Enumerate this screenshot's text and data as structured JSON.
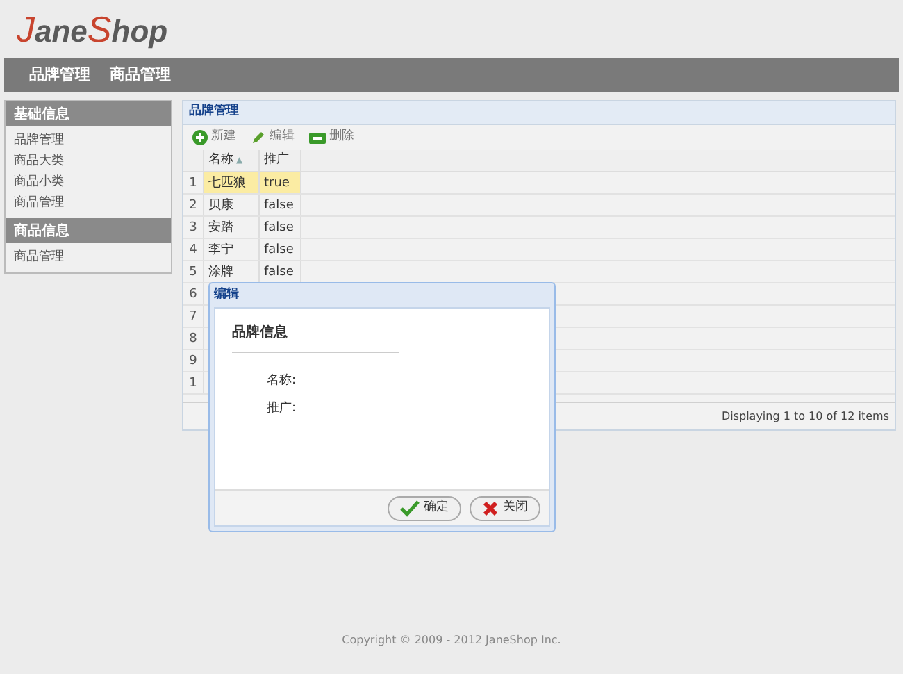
{
  "logo": {
    "parts": [
      "J",
      "ane",
      "S",
      "hop"
    ]
  },
  "nav": [
    "品牌管理",
    "商品管理"
  ],
  "sidebar": [
    {
      "title": "基础信息",
      "items": [
        "品牌管理",
        "商品大类",
        "商品小类",
        "商品管理"
      ]
    },
    {
      "title": "商品信息",
      "items": [
        "商品管理"
      ]
    }
  ],
  "panel": {
    "title": "品牌管理",
    "toolbar": [
      {
        "kind": "add",
        "label": "新建"
      },
      {
        "kind": "edit",
        "label": "编辑"
      },
      {
        "kind": "remove",
        "label": "删除"
      }
    ],
    "columns": [
      {
        "label": "名称",
        "sort_arrow": "▲"
      },
      {
        "label": "推广"
      }
    ],
    "rows": [
      {
        "index": "1",
        "cells": [
          "七匹狼",
          "true"
        ],
        "selected": true
      },
      {
        "index": "2",
        "cells": [
          "贝康",
          "false"
        ],
        "selected": false
      },
      {
        "index": "3",
        "cells": [
          "安踏",
          "false"
        ],
        "selected": false
      },
      {
        "index": "4",
        "cells": [
          "李宁",
          "false"
        ],
        "selected": false
      },
      {
        "index": "5",
        "cells": [
          "涂牌",
          "false"
        ],
        "selected": false
      },
      {
        "index": "6",
        "cells": []
      },
      {
        "index": "7",
        "cells": []
      },
      {
        "index": "8",
        "cells": []
      },
      {
        "index": "9",
        "cells": []
      },
      {
        "index": "1",
        "cells": []
      }
    ],
    "pager": "Displaying 1 to 10 of 12 items"
  },
  "dialog": {
    "title": "编辑",
    "section": "品牌信息",
    "fields": [
      "名称:",
      "推广:"
    ],
    "buttons": [
      {
        "kind": "ok",
        "label": "确定"
      },
      {
        "kind": "close",
        "label": "关闭"
      }
    ]
  },
  "footer": "Copyright © 2009 - 2012 JaneShop Inc."
}
